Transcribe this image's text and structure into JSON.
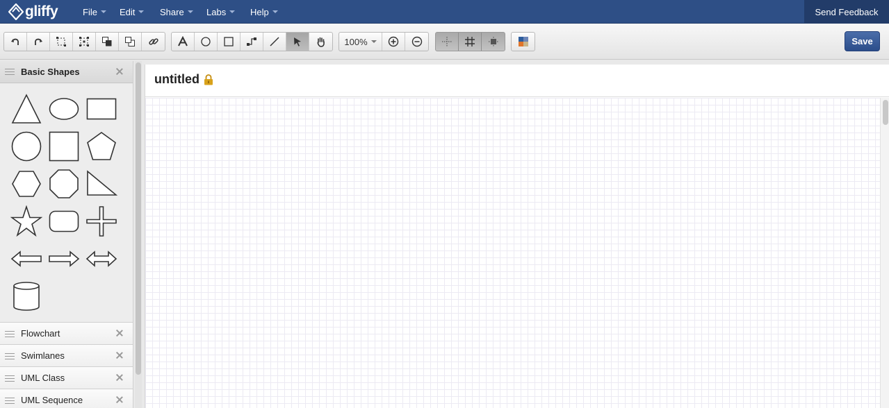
{
  "app": {
    "logo_text": "gliffy"
  },
  "menubar": {
    "items": [
      "File",
      "Edit",
      "Share",
      "Labs",
      "Help"
    ],
    "send_feedback": "Send Feedback",
    "bg_color": "#2e4f86"
  },
  "toolbar": {
    "zoom": "100%",
    "save_label": "Save",
    "tools": [
      "undo-icon",
      "redo-icon",
      "select-group-icon",
      "ungroup-icon",
      "bring-front-icon",
      "send-back-icon",
      "link-icon",
      "text-tool-icon",
      "ellipse-tool-icon",
      "rectangle-tool-icon",
      "connector-tool-icon",
      "line-tool-icon",
      "pointer-tool-icon",
      "pan-tool-icon",
      "zoom-in-icon",
      "zoom-out-icon",
      "snap-icon",
      "grid-icon",
      "snap-objects-icon",
      "theme-icon"
    ]
  },
  "left_panel": {
    "active_library": "Basic Shapes",
    "shapes": [
      "triangle",
      "ellipse",
      "rectangle",
      "circle",
      "square",
      "pentagon",
      "hexagon",
      "octagon",
      "right-triangle",
      "star",
      "rounded-rectangle",
      "cross",
      "left-arrow",
      "right-arrow",
      "double-arrow",
      "cylinder"
    ],
    "libraries": [
      "Flowchart",
      "Swimlanes",
      "UML Class",
      "UML Sequence"
    ]
  },
  "document": {
    "title": "untitled",
    "lock_color": "#d9a21b"
  }
}
